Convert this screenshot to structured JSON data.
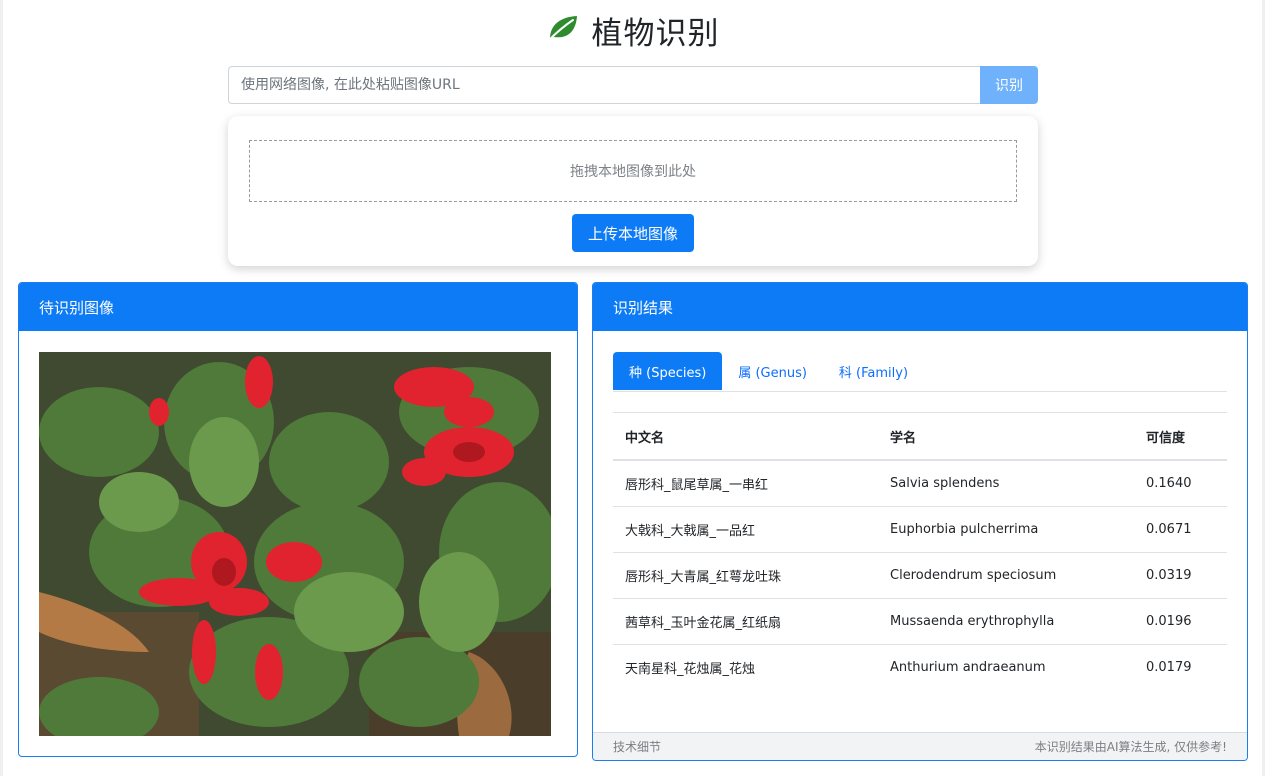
{
  "header": {
    "title": "植物识别",
    "icon": "leaf-icon",
    "icon_color": "#2e8b2e"
  },
  "url_search": {
    "placeholder": "使用网络图像, 在此处粘贴图像URL",
    "button_label": "识别"
  },
  "upload": {
    "dropzone_text": "拖拽本地图像到此处",
    "button_label": "上传本地图像"
  },
  "image_panel": {
    "title": "待识别图像"
  },
  "result_panel": {
    "title": "识别结果",
    "tabs": [
      {
        "label": "种 (Species)",
        "active": true
      },
      {
        "label": "属 (Genus)",
        "active": false
      },
      {
        "label": "科 (Family)",
        "active": false
      }
    ],
    "columns": [
      "中文名",
      "学名",
      "可信度"
    ],
    "rows": [
      {
        "cn": "唇形科_鼠尾草属_一串红",
        "sci": "Salvia splendens",
        "conf": "0.1640"
      },
      {
        "cn": "大戟科_大戟属_一品红",
        "sci": "Euphorbia pulcherrima",
        "conf": "0.0671"
      },
      {
        "cn": "唇形科_大青属_红萼龙吐珠",
        "sci": "Clerodendrum speciosum",
        "conf": "0.0319"
      },
      {
        "cn": "茜草科_玉叶金花属_红纸扇",
        "sci": "Mussaenda erythrophylla",
        "conf": "0.0196"
      },
      {
        "cn": "天南星科_花烛属_花烛",
        "sci": "Anthurium andraeanum",
        "conf": "0.0179"
      }
    ],
    "footer_left": "技术细节",
    "footer_right": "本识别结果由AI算法生成, 仅供参考!"
  },
  "colors": {
    "primary": "#0d7bf5",
    "primary_light": "#6fb2fb"
  }
}
